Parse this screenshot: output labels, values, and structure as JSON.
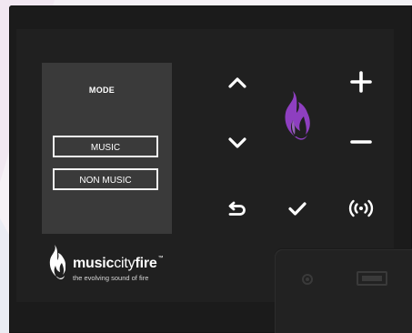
{
  "mode_panel": {
    "title": "MODE",
    "options": [
      {
        "label": "MUSIC"
      },
      {
        "label": "NON MUSIC"
      }
    ]
  },
  "controls": {
    "up_icon": "chevron-up-icon",
    "down_icon": "chevron-down-icon",
    "plus_icon": "plus-icon",
    "minus_icon": "minus-icon",
    "back_icon": "return-icon",
    "confirm_icon": "checkmark-icon",
    "wireless_icon": "wireless-signal-icon"
  },
  "brand": {
    "name_part1": "music",
    "name_part2": "city",
    "name_part3": "fire",
    "trademark": "™",
    "tagline": "the evolving sound of fire",
    "flame_color": "#8e3fc0",
    "flame_highlight": "#b474e0"
  },
  "colors": {
    "device_body": "#1b1b1b",
    "screen": "#202020",
    "mode_panel": "#3a3a3a",
    "button_outline": "#f2f2f2"
  }
}
